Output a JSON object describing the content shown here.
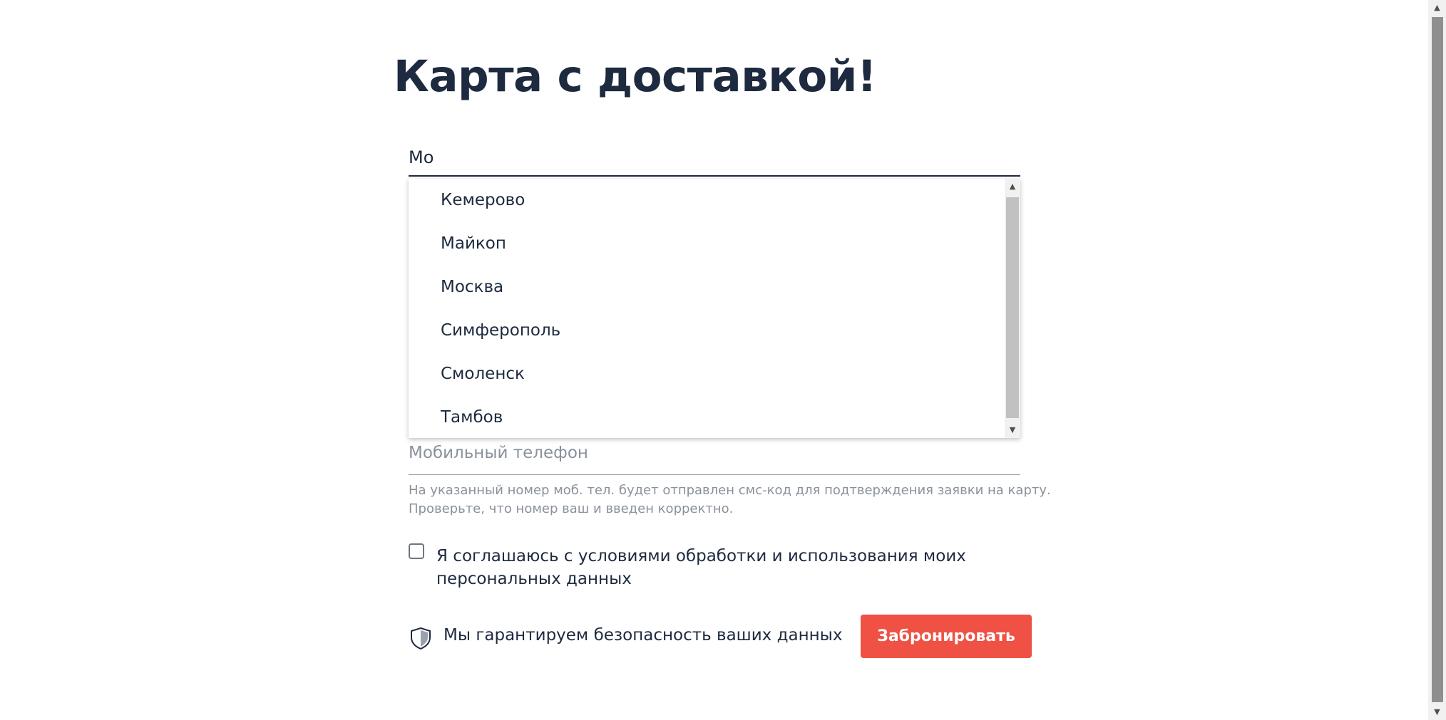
{
  "page": {
    "title": "Карта с доставкой!"
  },
  "city_input": {
    "value": "Мо"
  },
  "city_dropdown": {
    "options": [
      {
        "label": "Кемерово"
      },
      {
        "label": "Майкоп"
      },
      {
        "label": "Москва"
      },
      {
        "label": "Симферополь"
      },
      {
        "label": "Смоленск"
      },
      {
        "label": "Тамбов"
      }
    ]
  },
  "phone": {
    "placeholder": "Мобильный телефон",
    "hint_line1": "На указанный номер моб. тел. будет отправлен смс-код для подтверждения заявки на карту.",
    "hint_line2": "Проверьте, что номер ваш и введен корректно."
  },
  "consent": {
    "line1": "Я соглашаюсь с условиями обработки и использования моих",
    "line2": "персональных данных",
    "checked": false
  },
  "security": {
    "text": "Мы гарантируем безопасность ваших данных",
    "icon": "shield-icon"
  },
  "submit": {
    "label": "Забронировать"
  },
  "colors": {
    "primary_text": "#1d2a3f",
    "muted_text": "#8a919b",
    "accent": "#ef5145"
  }
}
